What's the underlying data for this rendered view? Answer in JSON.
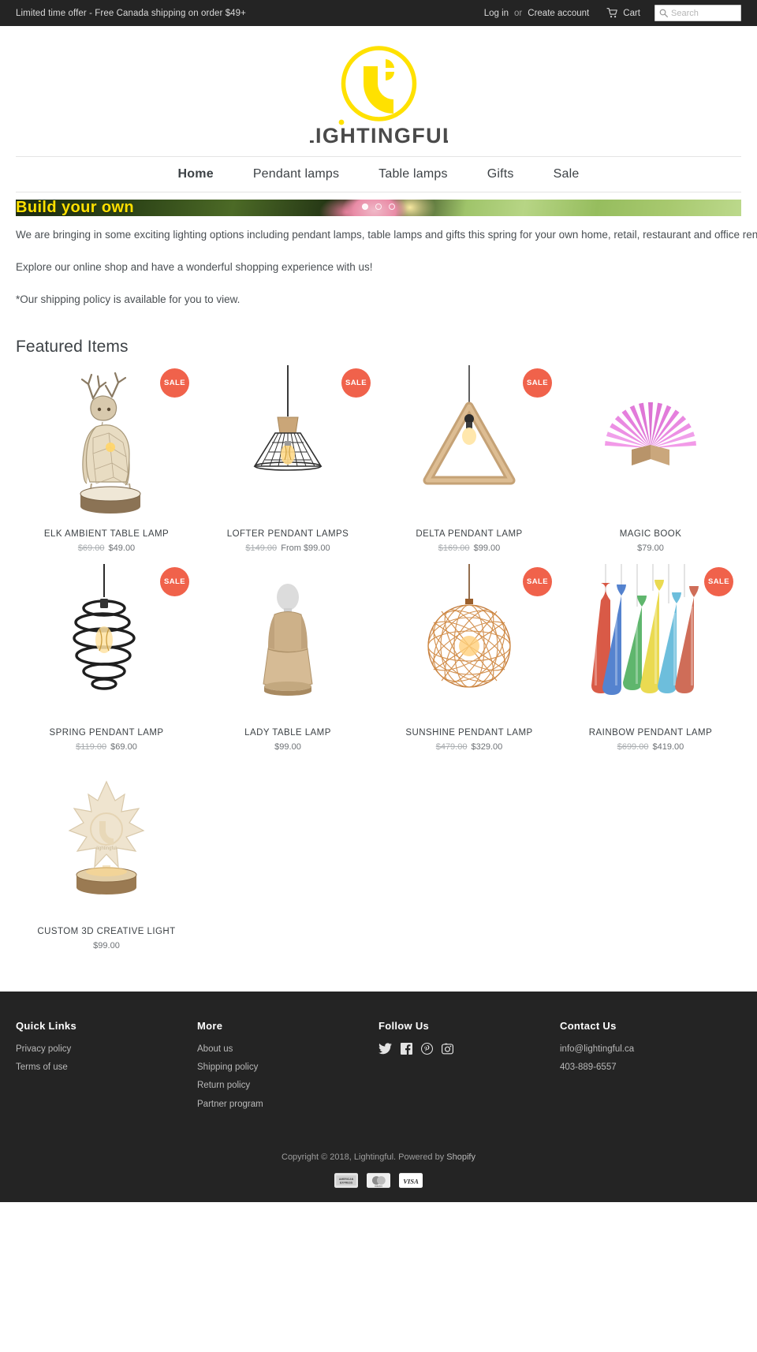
{
  "topbar": {
    "announcement": "Limited time offer - Free Canada shipping on order $49+",
    "login": "Log in",
    "or": "or",
    "create_account": "Create account",
    "cart": "Cart",
    "search_placeholder": "Search"
  },
  "header": {
    "brand": "LIGHTINGFUL"
  },
  "nav": [
    {
      "label": "Home",
      "active": true
    },
    {
      "label": "Pendant lamps",
      "active": false
    },
    {
      "label": "Table lamps",
      "active": false
    },
    {
      "label": "Gifts",
      "active": false
    },
    {
      "label": "Sale",
      "active": false
    }
  ],
  "slideshow": {
    "title": "Build your own",
    "dots": 3,
    "active_dot": 0
  },
  "richtext": {
    "p1": "We are bringing in some exciting lighting options including pendant lamps, table lamps and gifts this spring for your own home, retail, restaurant and office renovations.",
    "p2": "Explore our online shop and have a wonderful shopping experience with us!",
    "p3": "*Our shipping policy is available for you to view."
  },
  "featured": {
    "heading": "Featured Items",
    "sale_badge": "SALE",
    "products": [
      {
        "title": "Elk Ambient Table Lamp",
        "was": "$69.00",
        "now": "$49.00",
        "sale": true,
        "art": "elk"
      },
      {
        "title": "Lofter Pendant Lamps",
        "was": "$149.00",
        "now": "From $99.00",
        "sale": true,
        "art": "lofter"
      },
      {
        "title": "Delta Pendant Lamp",
        "was": "$169.00",
        "now": "$99.00",
        "sale": true,
        "art": "delta"
      },
      {
        "title": "Magic Book",
        "was": "",
        "now": "$79.00",
        "sale": false,
        "art": "magicbook"
      },
      {
        "title": "Spring Pendant Lamp",
        "was": "$119.00",
        "now": "$69.00",
        "sale": true,
        "art": "spring"
      },
      {
        "title": "Lady Table Lamp",
        "was": "",
        "now": "$99.00",
        "sale": false,
        "art": "lady"
      },
      {
        "title": "Sunshine Pendant Lamp",
        "was": "$479.00",
        "now": "$329.00",
        "sale": true,
        "art": "sunshine"
      },
      {
        "title": "Rainbow Pendant Lamp",
        "was": "$699.00",
        "now": "$419.00",
        "sale": true,
        "art": "rainbow"
      },
      {
        "title": "Custom 3D Creative Light",
        "was": "",
        "now": "$99.00",
        "sale": false,
        "art": "custom3d"
      }
    ]
  },
  "footer": {
    "quick_links": {
      "heading": "Quick Links",
      "items": [
        "Privacy policy",
        "Terms of use"
      ]
    },
    "more": {
      "heading": "More",
      "items": [
        "About us",
        "Shipping policy",
        "Return policy",
        "Partner program"
      ]
    },
    "follow": {
      "heading": "Follow Us",
      "icons": [
        "twitter-icon",
        "facebook-icon",
        "pinterest-icon",
        "instagram-icon"
      ]
    },
    "contact": {
      "heading": "Contact Us",
      "email": "info@lightingful.ca",
      "phone": "403-889-6557"
    },
    "copyright_pre": "Copyright © 2018, Lightingful. Powered by ",
    "copyright_link": "Shopify",
    "payments": [
      "american-express",
      "master",
      "visa"
    ]
  },
  "colors": {
    "accent_yellow": "#FFE100",
    "sale_red": "#F0624B",
    "dark": "#242424",
    "text": "#3D4246"
  }
}
